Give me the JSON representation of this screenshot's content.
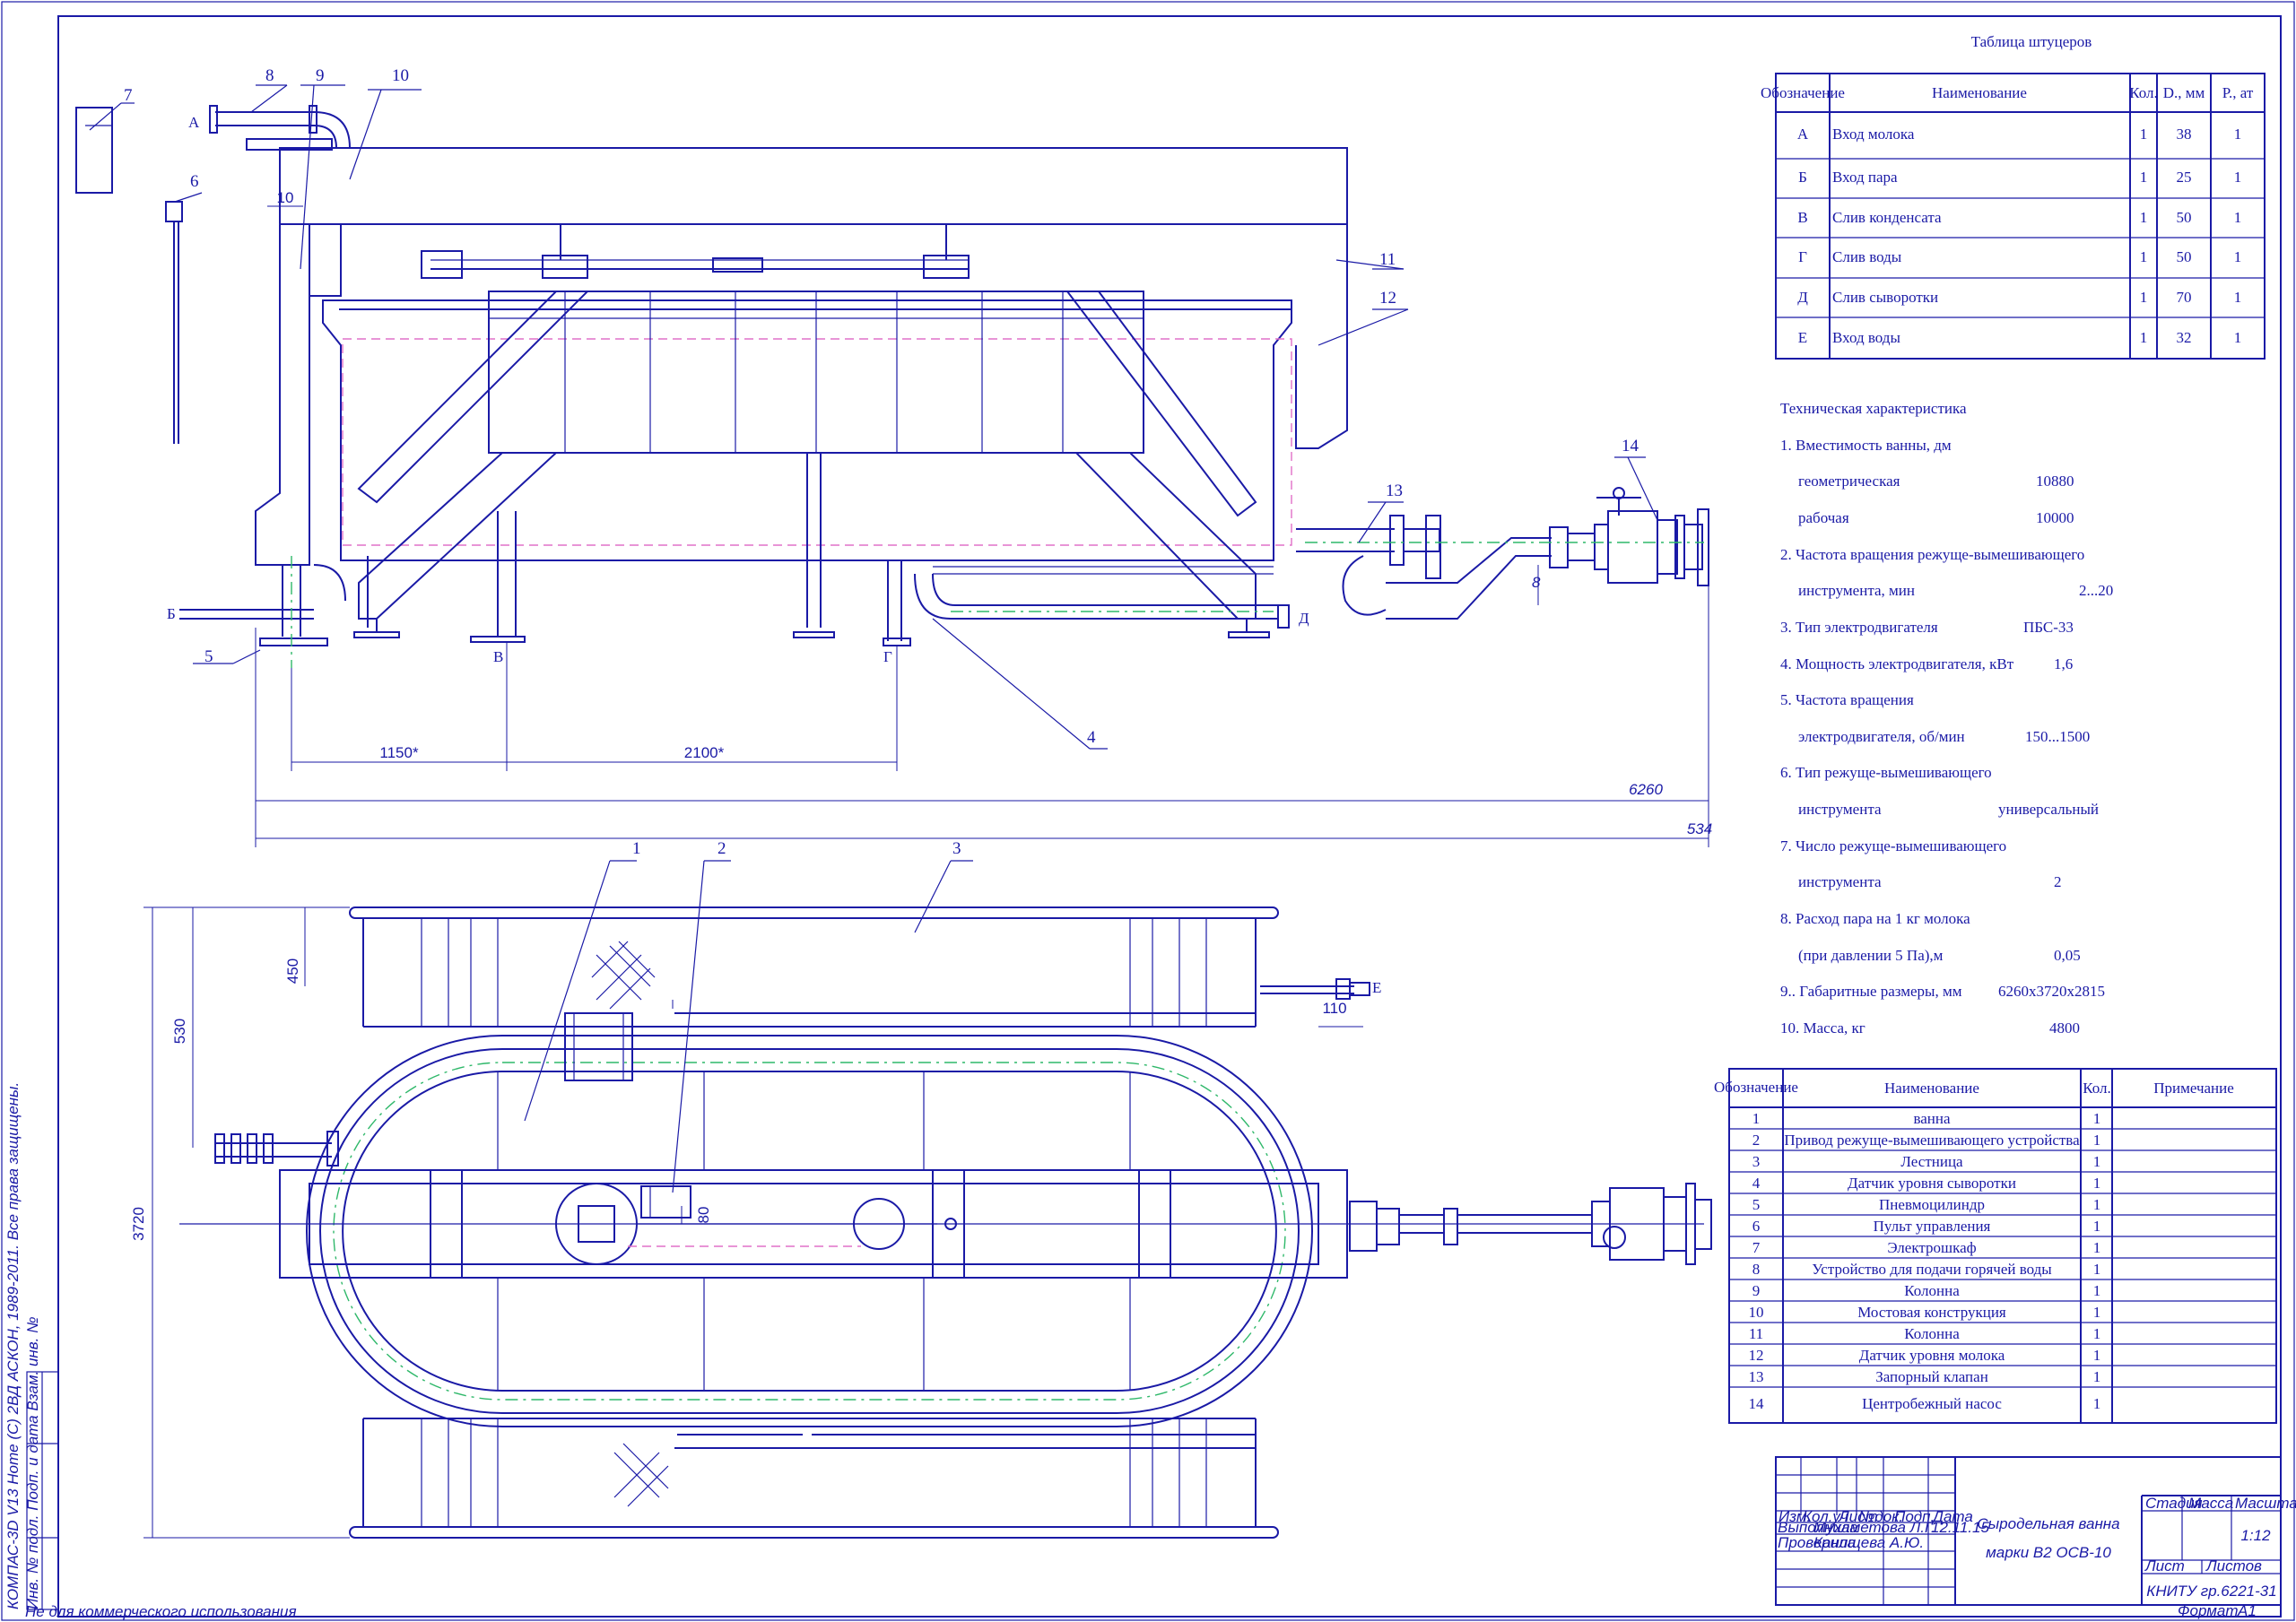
{
  "colors": {
    "line": "#1a1aa6",
    "axis": "#2fb86a",
    "hidden": "#e070c8"
  },
  "nozzles": {
    "title": "Таблица штуцеров",
    "headers": [
      "Обозначение",
      "Наименование",
      "Кол.",
      "D., мм",
      "Р., ат"
    ],
    "rows": [
      [
        "А",
        "Вход молока",
        "1",
        "38",
        "1"
      ],
      [
        "Б",
        "Вход пара",
        "1",
        "25",
        "1"
      ],
      [
        "В",
        "Слив конденсата",
        "1",
        "50",
        "1"
      ],
      [
        "Г",
        "Слив воды",
        "1",
        "50",
        "1"
      ],
      [
        "Д",
        "Слив сыворотки",
        "1",
        "70",
        "1"
      ],
      [
        "Е",
        "Вход воды",
        "1",
        "32",
        "1"
      ]
    ]
  },
  "tech": {
    "title": "Техническая характеристика",
    "lines": [
      [
        "1. Вместимость ванны, дм",
        ""
      ],
      [
        "    геометрическая",
        "10880"
      ],
      [
        "    рабочая",
        "10000"
      ],
      [
        "2. Частота вращения режуще-вымешивающего",
        ""
      ],
      [
        "    инструмента, мин",
        "2...20"
      ],
      [
        "3. Тип электродвигателя",
        "ПБС-33"
      ],
      [
        "4. Мощность электродвигателя, кВт",
        "1,6"
      ],
      [
        "5. Частота вращения",
        ""
      ],
      [
        "    электродвигателя, об/мин",
        "150...1500"
      ],
      [
        "6. Тип режуще-вымешивающего",
        ""
      ],
      [
        "    инструмента",
        "универсальный"
      ],
      [
        "7. Число режуще-вымешивающего",
        ""
      ],
      [
        "    инструмента",
        "2"
      ],
      [
        "8. Расход пара на 1 кг молока",
        ""
      ],
      [
        "    (при давлении 5 Па),м",
        "0,05"
      ],
      [
        "9.. Габаритные размеры, мм",
        "6260х3720х2815"
      ],
      [
        "10. Масса, кг",
        "4800"
      ]
    ]
  },
  "parts": {
    "headers": [
      "Обозначение",
      "Наименование",
      "Кол.",
      "Примечание"
    ],
    "rows": [
      [
        "1",
        "ванна",
        "1"
      ],
      [
        "2",
        "Привод режуще-вымешивающего устройства",
        "1"
      ],
      [
        "3",
        "Лестница",
        "1"
      ],
      [
        "4",
        "Датчик уровня сыворотки",
        "1"
      ],
      [
        "5",
        "Пневмоцилиндр",
        "1"
      ],
      [
        "6",
        "Пульт управления",
        "1"
      ],
      [
        "7",
        "Электрошкаф",
        "1"
      ],
      [
        "8",
        "Устройство для подачи горячей воды",
        "1"
      ],
      [
        "9",
        "Колонна",
        "1"
      ],
      [
        "10",
        "Мостовая конструкция",
        "1"
      ],
      [
        "11",
        "Колонна",
        "1"
      ],
      [
        "12",
        "Датчик уровня молока",
        "1"
      ],
      [
        "13",
        "Запорный клапан",
        "1"
      ],
      [
        "14",
        "Центробежный насос",
        "1"
      ]
    ]
  },
  "callouts": [
    "1",
    "2",
    "3",
    "4",
    "5",
    "6",
    "7",
    "8",
    "9",
    "10",
    "11",
    "12",
    "13",
    "14"
  ],
  "ports": {
    "a": "А",
    "b": "Б",
    "v": "В",
    "g": "Г",
    "d": "Д",
    "e": "Е"
  },
  "dims": {
    "d1150": "1150*",
    "d2100": "2100*",
    "d6260": "6260",
    "d534": "534",
    "d10": "10",
    "d8": "8",
    "d450": "450",
    "d530": "530",
    "d3720": "3720",
    "d110": "110",
    "d80": "80"
  },
  "titleblock": {
    "drawing_title_1": "Сыродельная ванна",
    "drawing_title_2": "марки В2 ОСВ-10",
    "stage": "Стадия",
    "mass": "Масса",
    "scale": "Масштаб",
    "scale_value": "1:12",
    "sheet": "Лист",
    "sheets": "Листов",
    "org": "КНИТУ гр.6221-31",
    "col_izm": "Изм.",
    "col_kol": "Кол.уч",
    "col_list": "Лист",
    "col_doc": "№док.",
    "col_podp": "Подп.",
    "col_date": "Дата",
    "row_vyp": "Выполнила",
    "row_vyp_name": "Мухаметова Л.Г.",
    "row_prov": "Проверила",
    "row_prov_name": "Канищева А.Ю.",
    "date_value": "12.11.15",
    "format": "Формат",
    "format_value": "А1"
  },
  "side_stamp": {
    "text1": "КОМПАС-3D V13 Home (С) 2ВД АСКОН, 1989-2011. Все права защищены.",
    "text2": "Инв. № подл.   Подп. и дата   Взам. инв. №"
  },
  "footer": {
    "noncommercial": "Не для коммерческого использования"
  }
}
